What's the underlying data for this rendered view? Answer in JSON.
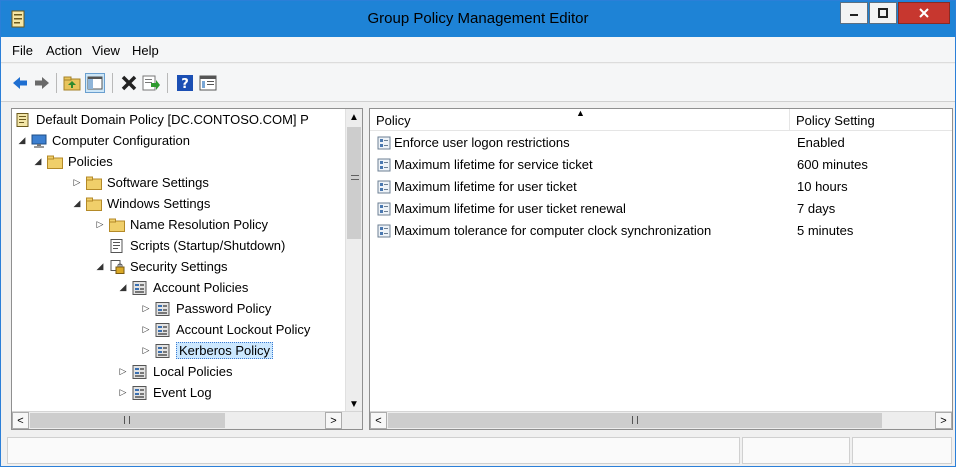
{
  "window": {
    "title": "Group Policy Management Editor"
  },
  "menu": {
    "items": [
      "File",
      "Action",
      "View",
      "Help"
    ]
  },
  "toolbar": {
    "buttons": [
      "back-icon",
      "forward-icon",
      "up-folder-icon",
      "show-hide-tree-icon",
      "delete-icon",
      "export-list-icon",
      "help-icon",
      "properties-icon"
    ]
  },
  "tree": {
    "items": [
      {
        "label": "Default Domain Policy [DC.CONTOSO.COM] P",
        "icon": "policy-document-icon",
        "expander": ""
      },
      {
        "label": "Computer Configuration",
        "icon": "computer-icon",
        "expander": "◢"
      },
      {
        "label": "Policies",
        "icon": "folder-icon",
        "expander": "◢"
      },
      {
        "label": "Software Settings",
        "icon": "folder-icon",
        "expander": "▷"
      },
      {
        "label": "Windows Settings",
        "icon": "folder-icon",
        "expander": "◢"
      },
      {
        "label": "Name Resolution Policy",
        "icon": "folder-icon",
        "expander": "▷"
      },
      {
        "label": "Scripts (Startup/Shutdown)",
        "icon": "script-icon",
        "expander": ""
      },
      {
        "label": "Security Settings",
        "icon": "security-settings-icon",
        "expander": "◢"
      },
      {
        "label": "Account Policies",
        "icon": "policy-container-icon",
        "expander": "◢"
      },
      {
        "label": "Password Policy",
        "icon": "policy-container-icon",
        "expander": "▷"
      },
      {
        "label": "Account Lockout Policy",
        "icon": "policy-container-icon",
        "expander": "▷"
      },
      {
        "label": "Kerberos Policy",
        "icon": "policy-container-icon",
        "expander": "▷",
        "selected": true
      },
      {
        "label": "Local Policies",
        "icon": "policy-container-icon",
        "expander": "▷"
      },
      {
        "label": "Event Log",
        "icon": "policy-container-icon",
        "expander": "▷"
      }
    ]
  },
  "list": {
    "columns": [
      "Policy",
      "Policy Setting"
    ],
    "rows": [
      {
        "policy": "Enforce user logon restrictions",
        "setting": "Enabled"
      },
      {
        "policy": "Maximum lifetime for service ticket",
        "setting": "600 minutes"
      },
      {
        "policy": "Maximum lifetime for user ticket",
        "setting": "10 hours"
      },
      {
        "policy": "Maximum lifetime for user ticket renewal",
        "setting": "7 days"
      },
      {
        "policy": "Maximum tolerance for computer clock synchronization",
        "setting": "5 minutes"
      }
    ]
  },
  "colors": {
    "titlebar": "#1e83d6",
    "close_button": "#c7372f",
    "selection": "#cce8ff"
  }
}
